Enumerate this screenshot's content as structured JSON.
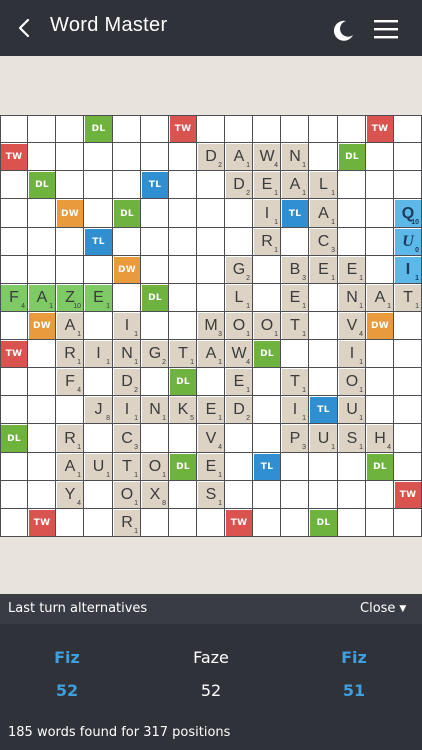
{
  "header": {
    "title": "Word Master"
  },
  "board": {
    "size": 15,
    "premiums": [
      {
        "r": 0,
        "c": 3,
        "t": "DL"
      },
      {
        "r": 0,
        "c": 6,
        "t": "TW"
      },
      {
        "r": 0,
        "c": 13,
        "t": "TW"
      },
      {
        "r": 1,
        "c": 0,
        "t": "TW"
      },
      {
        "r": 1,
        "c": 12,
        "t": "DL"
      },
      {
        "r": 2,
        "c": 1,
        "t": "DL"
      },
      {
        "r": 2,
        "c": 5,
        "t": "TL"
      },
      {
        "r": 3,
        "c": 2,
        "t": "DW"
      },
      {
        "r": 3,
        "c": 4,
        "t": "DL"
      },
      {
        "r": 3,
        "c": 10,
        "t": "TL"
      },
      {
        "r": 4,
        "c": 3,
        "t": "TL"
      },
      {
        "r": 5,
        "c": 4,
        "t": "DW"
      },
      {
        "r": 6,
        "c": 5,
        "t": "DL"
      },
      {
        "r": 7,
        "c": 1,
        "t": "DW"
      },
      {
        "r": 7,
        "c": 13,
        "t": "DW"
      },
      {
        "r": 8,
        "c": 0,
        "t": "TW"
      },
      {
        "r": 8,
        "c": 9,
        "t": "DL"
      },
      {
        "r": 9,
        "c": 6,
        "t": "DL"
      },
      {
        "r": 10,
        "c": 11,
        "t": "TL"
      },
      {
        "r": 11,
        "c": 0,
        "t": "DL"
      },
      {
        "r": 12,
        "c": 6,
        "t": "DL"
      },
      {
        "r": 12,
        "c": 9,
        "t": "TL"
      },
      {
        "r": 12,
        "c": 13,
        "t": "DL"
      },
      {
        "r": 13,
        "c": 14,
        "t": "TW"
      },
      {
        "r": 14,
        "c": 1,
        "t": "TW"
      },
      {
        "r": 14,
        "c": 8,
        "t": "TW"
      },
      {
        "r": 14,
        "c": 11,
        "t": "DL"
      }
    ],
    "tiles": [
      {
        "r": 1,
        "c": 7,
        "l": "D",
        "p": "2"
      },
      {
        "r": 1,
        "c": 8,
        "l": "A",
        "p": "1"
      },
      {
        "r": 1,
        "c": 9,
        "l": "W",
        "p": "4"
      },
      {
        "r": 1,
        "c": 10,
        "l": "N",
        "p": "1"
      },
      {
        "r": 2,
        "c": 8,
        "l": "D",
        "p": "2"
      },
      {
        "r": 2,
        "c": 9,
        "l": "E",
        "p": "1"
      },
      {
        "r": 2,
        "c": 10,
        "l": "A",
        "p": "1"
      },
      {
        "r": 2,
        "c": 11,
        "l": "L",
        "p": "1"
      },
      {
        "r": 3,
        "c": 9,
        "l": "I",
        "p": "1"
      },
      {
        "r": 3,
        "c": 11,
        "l": "A",
        "p": "1"
      },
      {
        "r": 4,
        "c": 9,
        "l": "R",
        "p": "1"
      },
      {
        "r": 4,
        "c": 11,
        "l": "C",
        "p": "3"
      },
      {
        "r": 5,
        "c": 8,
        "l": "G",
        "p": "2"
      },
      {
        "r": 5,
        "c": 10,
        "l": "B",
        "p": "3"
      },
      {
        "r": 5,
        "c": 11,
        "l": "E",
        "p": "1"
      },
      {
        "r": 5,
        "c": 12,
        "l": "E",
        "p": "1"
      },
      {
        "r": 6,
        "c": 8,
        "l": "L",
        "p": "1"
      },
      {
        "r": 6,
        "c": 10,
        "l": "E",
        "p": "1"
      },
      {
        "r": 6,
        "c": 12,
        "l": "N",
        "p": "1"
      },
      {
        "r": 6,
        "c": 13,
        "l": "A",
        "p": "1"
      },
      {
        "r": 6,
        "c": 14,
        "l": "T",
        "p": "1"
      },
      {
        "r": 7,
        "c": 2,
        "l": "A",
        "p": "1"
      },
      {
        "r": 7,
        "c": 4,
        "l": "I",
        "p": "1"
      },
      {
        "r": 7,
        "c": 7,
        "l": "M",
        "p": "3"
      },
      {
        "r": 7,
        "c": 8,
        "l": "O",
        "p": "1"
      },
      {
        "r": 7,
        "c": 9,
        "l": "O",
        "p": "1"
      },
      {
        "r": 7,
        "c": 10,
        "l": "T",
        "p": "1"
      },
      {
        "r": 7,
        "c": 12,
        "l": "V",
        "p": "4"
      },
      {
        "r": 8,
        "c": 2,
        "l": "R",
        "p": "1"
      },
      {
        "r": 8,
        "c": 3,
        "l": "I",
        "p": "1"
      },
      {
        "r": 8,
        "c": 4,
        "l": "N",
        "p": "1"
      },
      {
        "r": 8,
        "c": 5,
        "l": "G",
        "p": "2"
      },
      {
        "r": 8,
        "c": 6,
        "l": "T",
        "p": "1"
      },
      {
        "r": 8,
        "c": 7,
        "l": "A",
        "p": "1"
      },
      {
        "r": 8,
        "c": 8,
        "l": "W",
        "p": "4"
      },
      {
        "r": 8,
        "c": 12,
        "l": "I",
        "p": "1"
      },
      {
        "r": 9,
        "c": 2,
        "l": "F",
        "p": "4"
      },
      {
        "r": 9,
        "c": 4,
        "l": "D",
        "p": "2"
      },
      {
        "r": 9,
        "c": 8,
        "l": "E",
        "p": "1"
      },
      {
        "r": 9,
        "c": 10,
        "l": "T",
        "p": "1"
      },
      {
        "r": 9,
        "c": 12,
        "l": "O",
        "p": "1"
      },
      {
        "r": 10,
        "c": 3,
        "l": "J",
        "p": "8"
      },
      {
        "r": 10,
        "c": 4,
        "l": "I",
        "p": "1"
      },
      {
        "r": 10,
        "c": 5,
        "l": "N",
        "p": "1"
      },
      {
        "r": 10,
        "c": 6,
        "l": "K",
        "p": "5"
      },
      {
        "r": 10,
        "c": 7,
        "l": "E",
        "p": "1"
      },
      {
        "r": 10,
        "c": 8,
        "l": "D",
        "p": "2"
      },
      {
        "r": 10,
        "c": 10,
        "l": "I",
        "p": "1"
      },
      {
        "r": 10,
        "c": 12,
        "l": "U",
        "p": "1"
      },
      {
        "r": 11,
        "c": 2,
        "l": "R",
        "p": "1"
      },
      {
        "r": 11,
        "c": 4,
        "l": "C",
        "p": "3"
      },
      {
        "r": 11,
        "c": 7,
        "l": "V",
        "p": "4"
      },
      {
        "r": 11,
        "c": 10,
        "l": "P",
        "p": "3"
      },
      {
        "r": 11,
        "c": 11,
        "l": "U",
        "p": "1"
      },
      {
        "r": 11,
        "c": 12,
        "l": "S",
        "p": "1"
      },
      {
        "r": 11,
        "c": 13,
        "l": "H",
        "p": "4"
      },
      {
        "r": 12,
        "c": 2,
        "l": "A",
        "p": "1"
      },
      {
        "r": 12,
        "c": 3,
        "l": "U",
        "p": "1"
      },
      {
        "r": 12,
        "c": 4,
        "l": "T",
        "p": "1"
      },
      {
        "r": 12,
        "c": 5,
        "l": "O",
        "p": "1"
      },
      {
        "r": 12,
        "c": 7,
        "l": "E",
        "p": "1"
      },
      {
        "r": 13,
        "c": 2,
        "l": "Y",
        "p": "4"
      },
      {
        "r": 13,
        "c": 4,
        "l": "O",
        "p": "1"
      },
      {
        "r": 13,
        "c": 5,
        "l": "X",
        "p": "8"
      },
      {
        "r": 13,
        "c": 7,
        "l": "S",
        "p": "1"
      },
      {
        "r": 14,
        "c": 4,
        "l": "R",
        "p": "1"
      }
    ],
    "green_tiles": [
      {
        "r": 6,
        "c": 0,
        "l": "F",
        "p": "4"
      },
      {
        "r": 6,
        "c": 1,
        "l": "A",
        "p": "1"
      },
      {
        "r": 6,
        "c": 2,
        "l": "Z",
        "p": "10"
      },
      {
        "r": 6,
        "c": 3,
        "l": "E",
        "p": "1"
      }
    ],
    "blue_tiles": [
      {
        "r": 3,
        "c": 14,
        "l": "Q",
        "p": "10",
        "blank": false
      },
      {
        "r": 4,
        "c": 14,
        "l": "U",
        "p": "0",
        "blank": true
      },
      {
        "r": 5,
        "c": 14,
        "l": "I",
        "p": "1",
        "blank": false
      }
    ]
  },
  "colors": {
    "tw": "#d9534f",
    "dw": "#e89a3c",
    "tl": "#2f8fd0",
    "dl": "#6fb33f",
    "tile": "#ddd3c4",
    "green_tile": "#7ecb66",
    "blue_tile": "#5bb8e8"
  },
  "panel": {
    "title": "Last turn alternatives",
    "close_label": "Close",
    "alternatives": [
      {
        "word": "Fiz",
        "score": "52"
      },
      {
        "word": "Faze",
        "score": "52"
      },
      {
        "word": "Fiz",
        "score": "51"
      }
    ],
    "summary": "185 words found for 317 positions"
  }
}
